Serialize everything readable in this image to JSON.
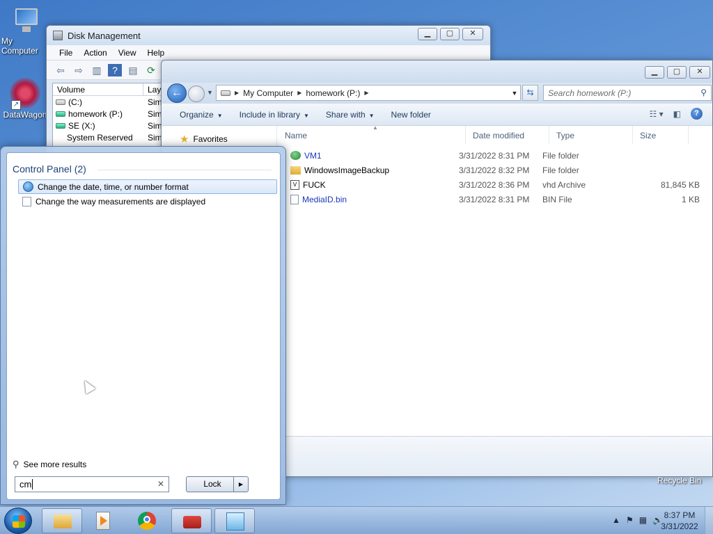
{
  "desktop": {
    "my_computer_label": "My Computer",
    "datawagon_label": "DataWagon",
    "recycle_bin_label": "Recycle Bin"
  },
  "disk_management": {
    "title": "Disk Management",
    "menu": [
      "File",
      "Action",
      "View",
      "Help"
    ],
    "columns": [
      "Volume",
      "Layo"
    ],
    "volumes": [
      {
        "name": "(C:)",
        "layout": "Sim",
        "color": "gray"
      },
      {
        "name": "homework (P:)",
        "layout": "Sim",
        "color": "green"
      },
      {
        "name": "SE (X:)",
        "layout": "Sim",
        "color": "green"
      },
      {
        "name": "System Reserved",
        "layout": "Sim",
        "color": "gray"
      }
    ]
  },
  "explorer": {
    "breadcrumb": [
      "My Computer",
      "homework (P:)"
    ],
    "search_placeholder": "Search homework (P:)",
    "commands": {
      "organize": "Organize",
      "include_in_library": "Include in library",
      "share_with": "Share with",
      "new_folder": "New folder"
    },
    "nav_favorites": "Favorites",
    "columns": {
      "name": "Name",
      "date": "Date modified",
      "type": "Type",
      "size": "Size"
    },
    "files": [
      {
        "name": "VM1",
        "date": "3/31/2022 8:31 PM",
        "type": "File folder",
        "size": "",
        "icon": "globe-folder",
        "blue": true
      },
      {
        "name": "WindowsImageBackup",
        "date": "3/31/2022 8:32 PM",
        "type": "File folder",
        "size": "",
        "icon": "folder",
        "blue": false
      },
      {
        "name": "FUCK",
        "date": "3/31/2022 8:36 PM",
        "type": "vhd Archive",
        "size": "81,845 KB",
        "icon": "vhd",
        "blue": false
      },
      {
        "name": "MediaID.bin",
        "date": "3/31/2022 8:31 PM",
        "type": "BIN File",
        "size": "1 KB",
        "icon": "file",
        "blue": true
      }
    ]
  },
  "start_menu": {
    "group_title": "Control Panel (2)",
    "results": [
      "Change the date, time, or number format",
      "Change the way measurements are displayed"
    ],
    "see_more": "See more results",
    "search_value": "cm",
    "lock_label": "Lock"
  },
  "taskbar": {
    "time": "8:37 PM",
    "date": "3/31/2022"
  }
}
